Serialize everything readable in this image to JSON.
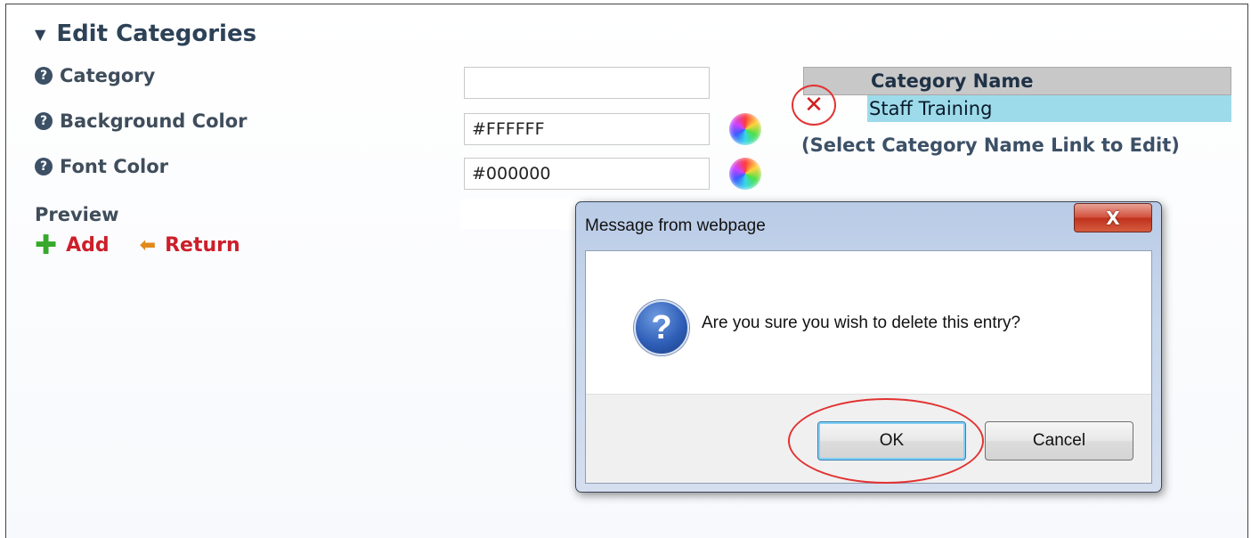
{
  "form": {
    "section_title": "Edit Categories",
    "fields": [
      {
        "label": "Category",
        "value": ""
      },
      {
        "label": "Background Color",
        "value": "#FFFFFF"
      },
      {
        "label": "Font Color",
        "value": "#000000"
      }
    ],
    "preview_label": "Preview",
    "actions": {
      "add_label": "Add",
      "return_label": "Return"
    }
  },
  "category_table": {
    "header": "Category Name",
    "rows": [
      {
        "name": "Staff Training",
        "delete_symbol": "✕",
        "highlight_color": "#9edbea"
      }
    ],
    "hint": "(Select Category Name Link to Edit)"
  },
  "dialog": {
    "title": "Message from webpage",
    "close_symbol": "X",
    "icon": "question-icon",
    "icon_glyph": "?",
    "message": "Are you sure you wish to delete this entry?",
    "ok_label": "OK",
    "cancel_label": "Cancel"
  },
  "colors": {
    "accent_red": "#cc1f2a",
    "annotation_red": "#e23232",
    "heading": "#2d4257"
  }
}
